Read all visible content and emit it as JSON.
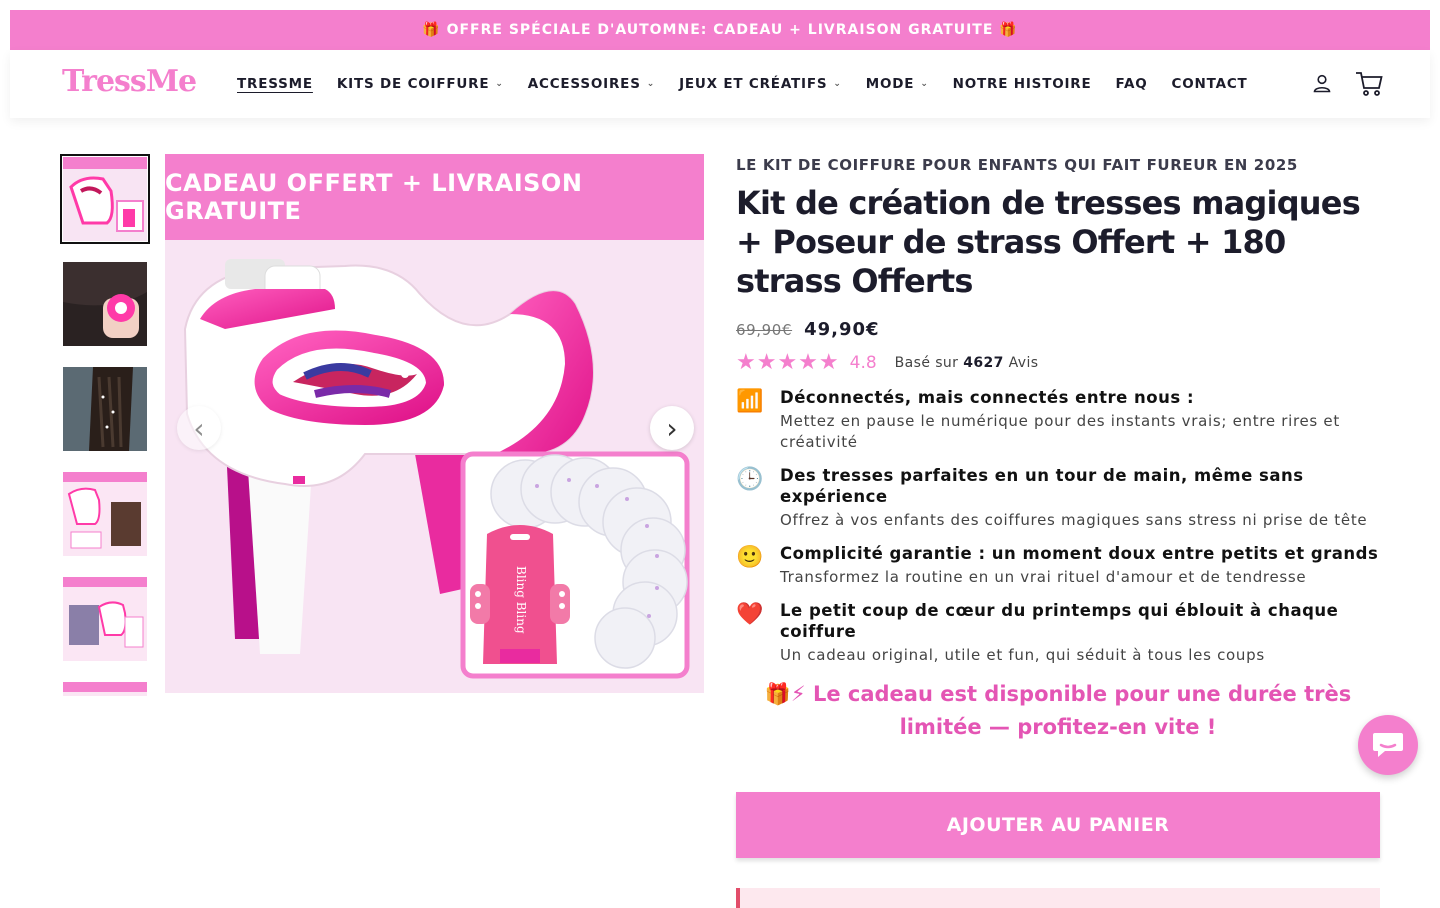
{
  "announcement": {
    "text": "🎁 OFFRE SPÉCIALE D'AUTOMNE: CADEAU + LIVRAISON GRATUITE 🎁"
  },
  "header": {
    "logo": "TressMe",
    "nav": [
      {
        "label": "TRESSME",
        "dropdown": false,
        "active": true
      },
      {
        "label": "KITS DE COIFFURE",
        "dropdown": true
      },
      {
        "label": "ACCESSOIRES",
        "dropdown": true
      },
      {
        "label": "JEUX ET CRÉATIFS",
        "dropdown": true
      },
      {
        "label": "MODE",
        "dropdown": true
      },
      {
        "label": "NOTRE HISTOIRE",
        "dropdown": false
      },
      {
        "label": "FAQ",
        "dropdown": false
      },
      {
        "label": "CONTACT",
        "dropdown": false
      }
    ],
    "icons": [
      "account-icon",
      "cart-icon"
    ]
  },
  "gallery": {
    "banner": "CADEAU OFFERT + LIVRAISON GRATUITE",
    "device_text": "Bling Bling",
    "thumbnail_count": 6,
    "selected_index": 0
  },
  "product": {
    "eyebrow": "LE KIT DE COIFFURE POUR ENFANTS QUI FAIT FUREUR EN 2025",
    "title": "Kit de création de tresses magiques + Poseur de strass Offert + 180 strass Offerts",
    "old_price": "69,90€",
    "price": "49,90€",
    "rating": "4.8",
    "stars": "★★★★★",
    "reviews_prefix": "Basé sur",
    "reviews_count": "4627",
    "reviews_suffix": "Avis",
    "features": [
      {
        "icon": "📶",
        "icon_name": "signal-bars-icon",
        "title": "Déconnectés, mais connectés entre nous :",
        "desc": "Mettez en pause le numérique pour des instants vrais; entre rires et créativité"
      },
      {
        "icon": "🕒",
        "icon_name": "clock-icon",
        "title": "Des tresses parfaites en un tour de main, même sans expérience",
        "desc": "Offrez à vos enfants des coiffures magiques sans stress ni prise de tête"
      },
      {
        "icon": "🙂",
        "icon_name": "smile-icon",
        "title": "Complicité garantie : un moment doux entre petits et grands",
        "desc": "Transformez la routine en un vrai rituel d'amour et de tendresse"
      },
      {
        "icon": "❤️",
        "icon_name": "heart-icon",
        "title": "Le petit coup de cœur du printemps qui éblouit à chaque coiffure",
        "desc": "Un cadeau original, utile et fun, qui séduit à tous les coups"
      }
    ],
    "promo": "🎁⚡ Le cadeau est disponible pour une durée très limitée — profitez-en vite !",
    "cta": "AJOUTER AU PANIER"
  },
  "colors": {
    "accent": "#f47fcd",
    "accent_dark": "#e455b4",
    "text": "#1c1c2b"
  }
}
